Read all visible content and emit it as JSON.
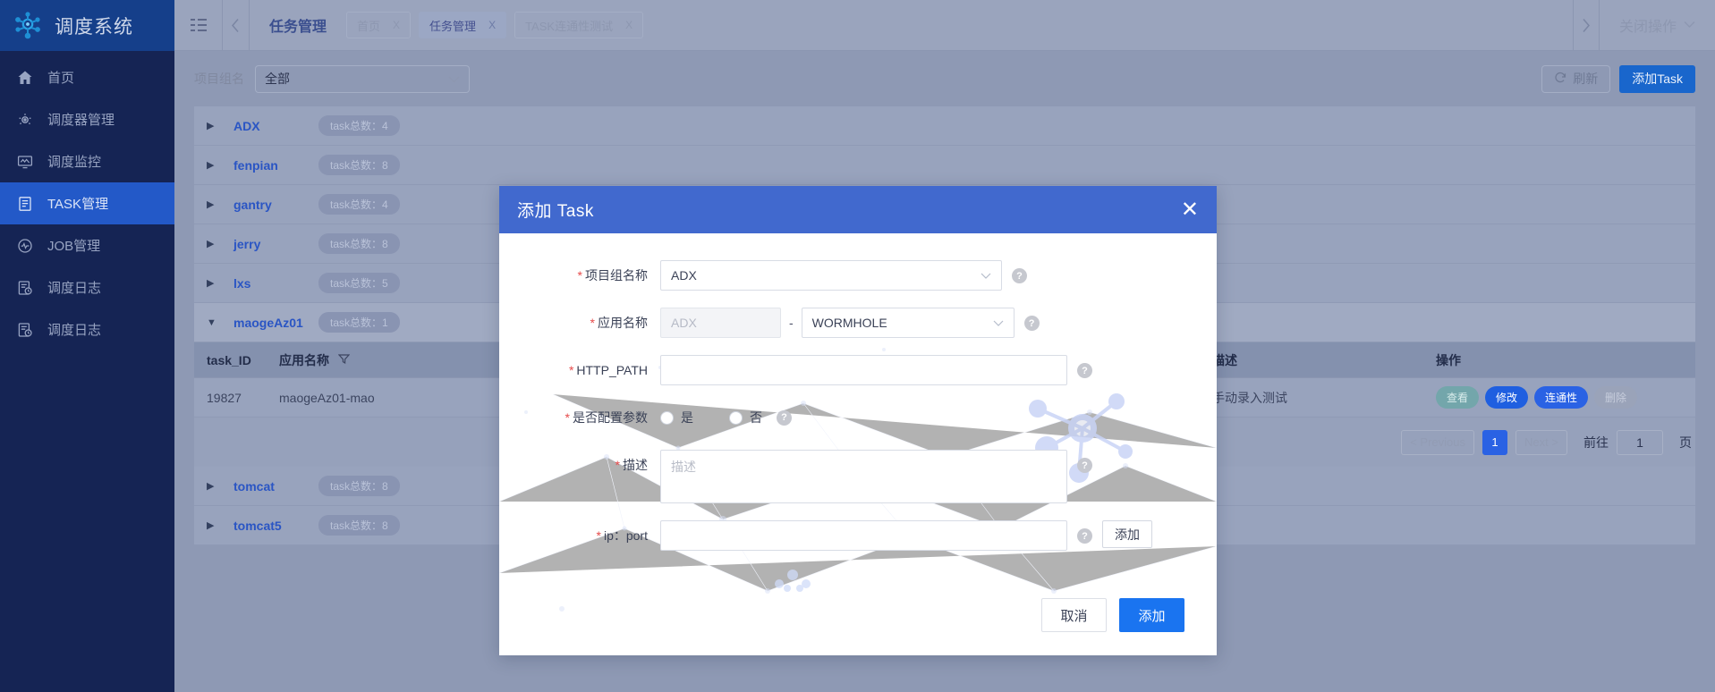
{
  "sidebar": {
    "logo_title": "调度系统",
    "items": [
      {
        "label": "首页",
        "icon": "home-icon"
      },
      {
        "label": "调度器管理",
        "icon": "scheduler-icon"
      },
      {
        "label": "调度监控",
        "icon": "monitor-icon"
      },
      {
        "label": "TASK管理",
        "icon": "task-icon"
      },
      {
        "label": "JOB管理",
        "icon": "job-icon"
      },
      {
        "label": "调度日志",
        "icon": "log-icon"
      },
      {
        "label": "调度日志",
        "icon": "log-icon"
      }
    ],
    "active_index": 3
  },
  "topbar": {
    "page_label": "任务管理",
    "tabs": [
      {
        "label": "首页",
        "close": "X",
        "active": false
      },
      {
        "label": "任务管理",
        "close": "X",
        "active": true
      },
      {
        "label": "TASK连通性测试",
        "close": "X",
        "active": false
      }
    ],
    "close_ops_label": "关闭操作"
  },
  "toolbar": {
    "filter_label": "项目组名",
    "filter_value": "全部",
    "refresh_label": "刷新",
    "add_task_label": "添加Task"
  },
  "groups": [
    {
      "name": "ADX",
      "badge": "task总数：4",
      "expanded": false
    },
    {
      "name": "fenpian",
      "badge": "task总数：8",
      "expanded": false
    },
    {
      "name": "gantry",
      "badge": "task总数：4",
      "expanded": false
    },
    {
      "name": "jerry",
      "badge": "task总数：8",
      "expanded": false
    },
    {
      "name": "lxs",
      "badge": "task总数：5",
      "expanded": false
    },
    {
      "name": "maogeAz01",
      "badge": "task总数：1",
      "expanded": true
    },
    {
      "name": "tomcat",
      "badge": "task总数：8",
      "expanded": false
    },
    {
      "name": "tomcat5",
      "badge": "task总数：8",
      "expanded": false
    }
  ],
  "subtable": {
    "columns": {
      "task_id": "task_ID",
      "app_name": "应用名称",
      "desc": "描述",
      "ops": "操作"
    },
    "rows": [
      {
        "task_id": "19827",
        "app_name": "maogeAz01-mao",
        "desc": "手动录入测试",
        "ops": [
          "查看",
          "修改",
          "连通性",
          "删除"
        ]
      }
    ]
  },
  "pagination": {
    "previous": "< Previous",
    "page": "1",
    "next": "Next >",
    "goto_label": "前往",
    "goto_value": "1",
    "page_unit": "页"
  },
  "modal": {
    "title": "添加 Task",
    "close": "✕",
    "fields": {
      "project_group": {
        "label": "项目组名称",
        "value": "ADX",
        "required": true
      },
      "app_name": {
        "label": "应用名称",
        "prefix_value": "ADX",
        "suffix_value": "WORMHOLE",
        "separator": "-",
        "required": true
      },
      "http_path": {
        "label": "HTTP_PATH",
        "value": "",
        "required": true
      },
      "config_params": {
        "label": "是否配置参数",
        "required": true,
        "options": [
          {
            "label": "是",
            "checked": false
          },
          {
            "label": "否",
            "checked": false
          }
        ]
      },
      "description": {
        "label": "描述",
        "value": "",
        "placeholder": "描述",
        "required": true
      },
      "ip_port": {
        "label": "ip：port",
        "value": "",
        "required": true,
        "add_label": "添加"
      }
    },
    "cancel_label": "取消",
    "confirm_label": "添加"
  },
  "colors": {
    "sidebar_bg": "#152454",
    "sidebar_logo_bg": "#153f8a",
    "accent_blue": "#2359c8",
    "modal_header": "#4169ce",
    "primary_button": "#1a74f0"
  }
}
